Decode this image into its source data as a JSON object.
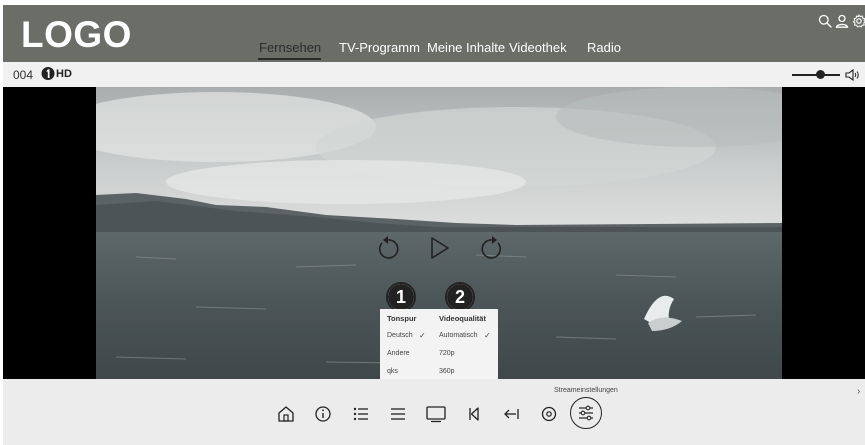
{
  "header": {
    "logo": "LOGO",
    "nav": [
      {
        "label": "Fernsehen",
        "active": true
      },
      {
        "label": "TV-Programm",
        "active": false
      },
      {
        "label": "Meine Inhalte",
        "active": false
      },
      {
        "label": "Videothek",
        "active": false
      },
      {
        "label": "Radio",
        "active": false
      }
    ],
    "icons": [
      "search-icon",
      "user-icon",
      "settings-icon"
    ]
  },
  "channel": {
    "number": "004",
    "hd": "HD"
  },
  "player": {
    "controls": [
      "rewind-icon",
      "play-icon",
      "forward-icon"
    ]
  },
  "stream_settings": {
    "label": "Streameinstellungen",
    "badges": [
      "1",
      "2"
    ],
    "audio": {
      "heading": "Tonspur",
      "options": [
        "Deutsch",
        "Andere",
        "qks"
      ],
      "selected": "Deutsch"
    },
    "video": {
      "heading": "Videoqualität",
      "options": [
        "Automatisch",
        "720p",
        "360p"
      ],
      "selected": "Automatisch"
    }
  },
  "bottom_bar": {
    "icons": [
      "home-icon",
      "info-icon",
      "list-icon",
      "menu-icon",
      "screen-icon",
      "skip-back-icon",
      "back-arrow-icon",
      "record-icon",
      "stream-settings-icon"
    ]
  },
  "colors": {
    "header_bg": "#6b6d67",
    "bar_bg": "#ececec",
    "text_dark": "#2b2b2b"
  }
}
